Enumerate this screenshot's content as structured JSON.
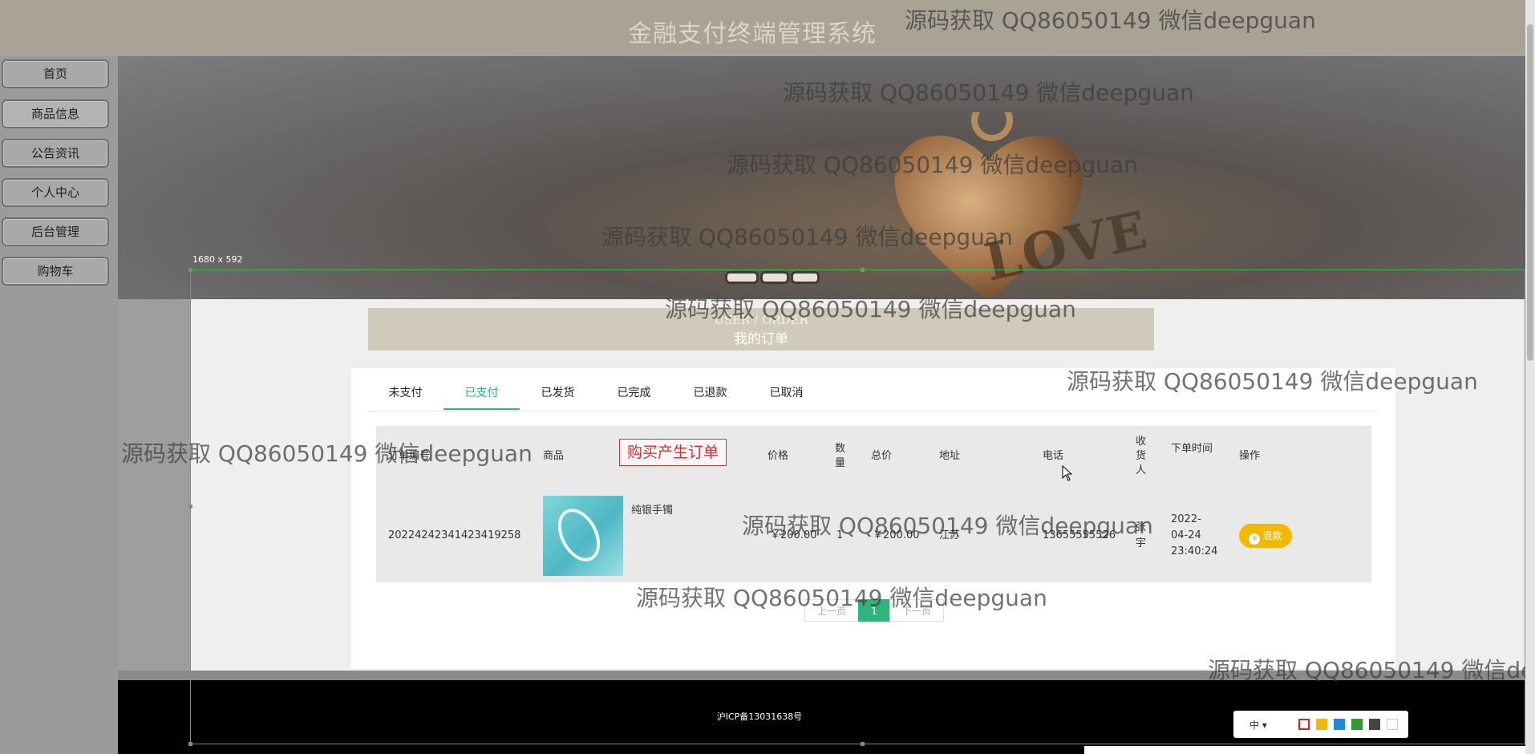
{
  "header": {
    "title": "金融支付终端管理系统"
  },
  "sidebar": {
    "items": [
      {
        "label": "首页"
      },
      {
        "label": "商品信息"
      },
      {
        "label": "公告资讯"
      },
      {
        "label": "个人中心"
      },
      {
        "label": "后台管理"
      },
      {
        "label": "购物车"
      }
    ]
  },
  "banner": {
    "image_text": "LOVE"
  },
  "section": {
    "title_en": "USER / ORDER",
    "title_zh": "我的订单"
  },
  "tabs": [
    {
      "label": "未支付"
    },
    {
      "label": "已支付"
    },
    {
      "label": "已发货"
    },
    {
      "label": "已完成"
    },
    {
      "label": "已退款"
    },
    {
      "label": "已取消"
    }
  ],
  "active_tab": "已支付",
  "table": {
    "headers": {
      "order_no": "订单编号",
      "product": "商品",
      "price": "价格",
      "qty": "数量",
      "total": "总价",
      "address": "地址",
      "phone": "电话",
      "receiver": "收货人",
      "time": "下单时间",
      "action": "操作"
    },
    "rows": [
      {
        "order_no": "20224242341423419258",
        "product": "纯银手镯",
        "price": "￥200.00",
        "qty": "1",
        "total": "￥200.00",
        "address": "江苏",
        "phone": "13655555526",
        "receiver": "张宇",
        "time": "2022-04-24 23:40:24",
        "action": "退款"
      }
    ]
  },
  "annotation": {
    "label": "购买产生订单"
  },
  "pagination": {
    "prev": "上一页",
    "current": "1",
    "next": "下一页"
  },
  "footer": {
    "icp": "沪ICP备13031638号"
  },
  "overlay": {
    "size_label": "1680 x 592"
  },
  "toolbar": {
    "lang": "中 ▾"
  },
  "watermark": "源码获取 QQ86050149 微信deepguan",
  "colors": {
    "accent": "#2fb47d",
    "refund": "#f5b800",
    "annotation": "#cc3333"
  }
}
